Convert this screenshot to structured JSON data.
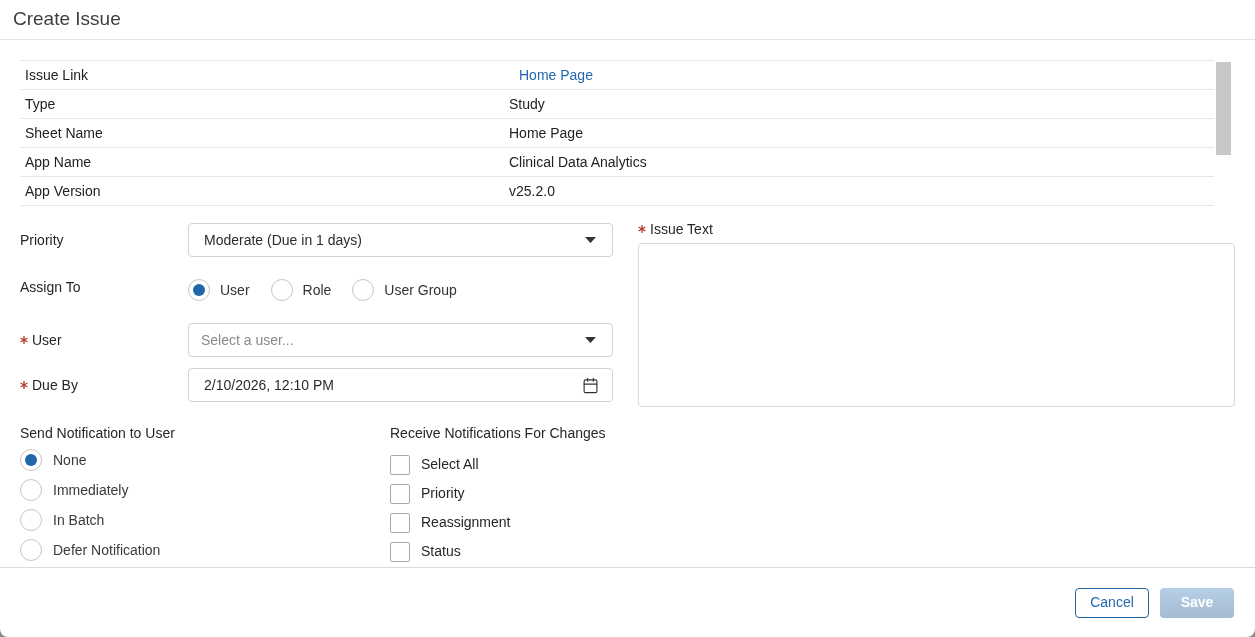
{
  "dialog": {
    "title": "Create Issue"
  },
  "details": [
    {
      "label": "Issue Link",
      "value": "Home Page",
      "kind": "link"
    },
    {
      "label": "Type",
      "value": "Study",
      "kind": "text"
    },
    {
      "label": "Sheet Name",
      "value": "Home Page",
      "kind": "text"
    },
    {
      "label": "App Name",
      "value": "Clinical Data Analytics",
      "kind": "text"
    },
    {
      "label": "App Version",
      "value": "v25.2.0",
      "kind": "text"
    }
  ],
  "form": {
    "priority": {
      "label": "Priority",
      "required": false,
      "value": "Moderate (Due in 1 days)"
    },
    "assign_to": {
      "label": "Assign To",
      "required": false,
      "options": [
        {
          "label": "User",
          "selected": true
        },
        {
          "label": "Role",
          "selected": false
        },
        {
          "label": "User Group",
          "selected": false
        }
      ]
    },
    "user": {
      "label": "User",
      "required": true,
      "placeholder": "Select a user..."
    },
    "due_by": {
      "label": "Due By",
      "required": true,
      "value": "2/10/2026, 12:10 PM"
    },
    "issue_text": {
      "label": "Issue Text",
      "required": true
    }
  },
  "send_notification": {
    "title": "Send Notification to User",
    "options": [
      {
        "label": "None",
        "selected": true
      },
      {
        "label": "Immediately",
        "selected": false
      },
      {
        "label": "In Batch",
        "selected": false
      },
      {
        "label": "Defer Notification",
        "selected": false
      }
    ]
  },
  "receive_notifications": {
    "title": "Receive Notifications For Changes",
    "options": [
      {
        "label": "Select All",
        "checked": false
      },
      {
        "label": "Priority",
        "checked": false
      },
      {
        "label": "Reassignment",
        "checked": false
      },
      {
        "label": "Status",
        "checked": false
      }
    ]
  },
  "buttons": [
    {
      "label": "Cancel",
      "kind": "secondary",
      "disabled": false
    },
    {
      "label": "Save",
      "kind": "primary",
      "disabled": true
    }
  ]
}
